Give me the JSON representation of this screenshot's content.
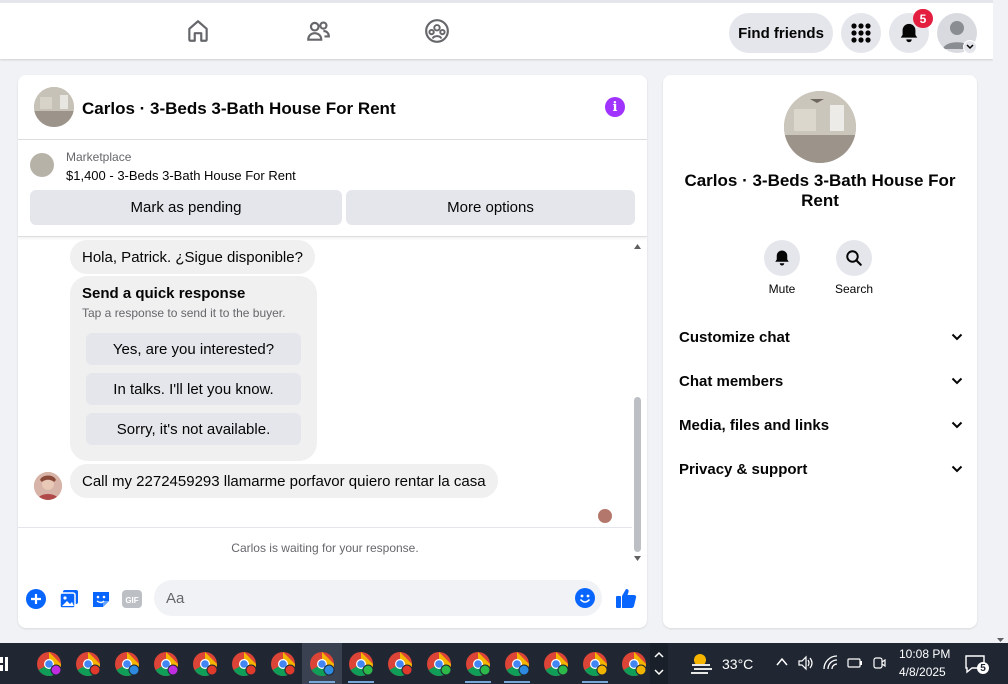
{
  "nav": {
    "find_friends": "Find friends",
    "notification_count": "5"
  },
  "chat": {
    "title": "Carlos · 3-Beds 3-Bath House For Rent",
    "marketplace_label": "Marketplace",
    "listing": "$1,400 - 3-Beds 3-Bath House For Rent",
    "mark_pending": "Mark as pending",
    "more_options": "More options",
    "messages": {
      "first": "Hola, Patrick. ¿Sigue disponible?",
      "last": "Call my 2272459293 llamarme porfavor quiero rentar la casa"
    },
    "quick_response": {
      "title": "Send a quick response",
      "subtitle": "Tap a response to send it to the buyer.",
      "options": [
        "Yes, are you interested?",
        "In talks. I'll let you know.",
        "Sorry, it's not available."
      ]
    },
    "waiting": "Carlos is waiting for your response.",
    "composer_placeholder": "Aa"
  },
  "info": {
    "name": "Carlos · 3-Beds 3-Bath House For Rent",
    "actions": {
      "mute": "Mute",
      "search": "Search"
    },
    "sections": [
      "Customize chat",
      "Chat members",
      "Media, files and links",
      "Privacy & support"
    ]
  },
  "taskbar": {
    "temperature": "33°C",
    "time": "10:08 PM",
    "date": "4/8/2025",
    "notification_count": "5"
  },
  "colors": {
    "messenger_blue": "#0866ff",
    "info_purple": "#a033ff",
    "badge_red": "#e41e3f"
  }
}
